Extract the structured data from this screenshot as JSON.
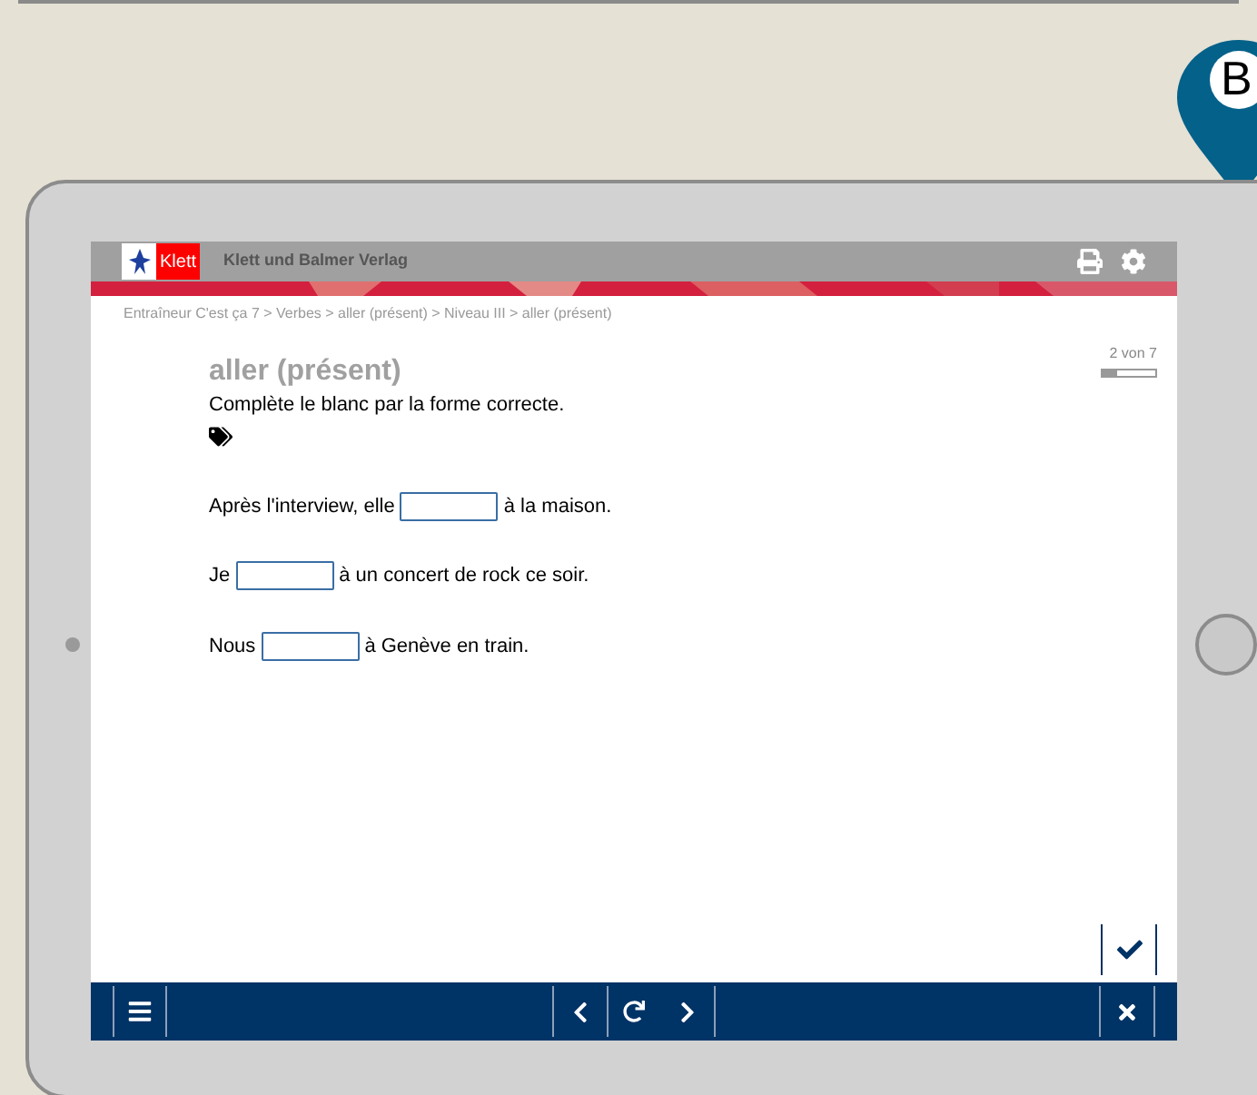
{
  "pin": {
    "label": "B"
  },
  "header": {
    "logo": "Klett",
    "publisher": "Klett und Balmer Verlag"
  },
  "breadcrumb": "Entraîneur C'est ça 7 > Verbes > aller (présent) > Niveau III > aller (présent)",
  "exercise": {
    "title": "aller (présent)",
    "instruction": "Complète le blanc par la forme correcte.",
    "counter": "2 von 7",
    "level": 0.29
  },
  "sentences": [
    {
      "before": "Après l'interview, elle",
      "after": "à la maison."
    },
    {
      "before": "Je",
      "after": "à un concert de rock ce soir."
    },
    {
      "before": "Nous",
      "after": "à Genève en train."
    }
  ]
}
